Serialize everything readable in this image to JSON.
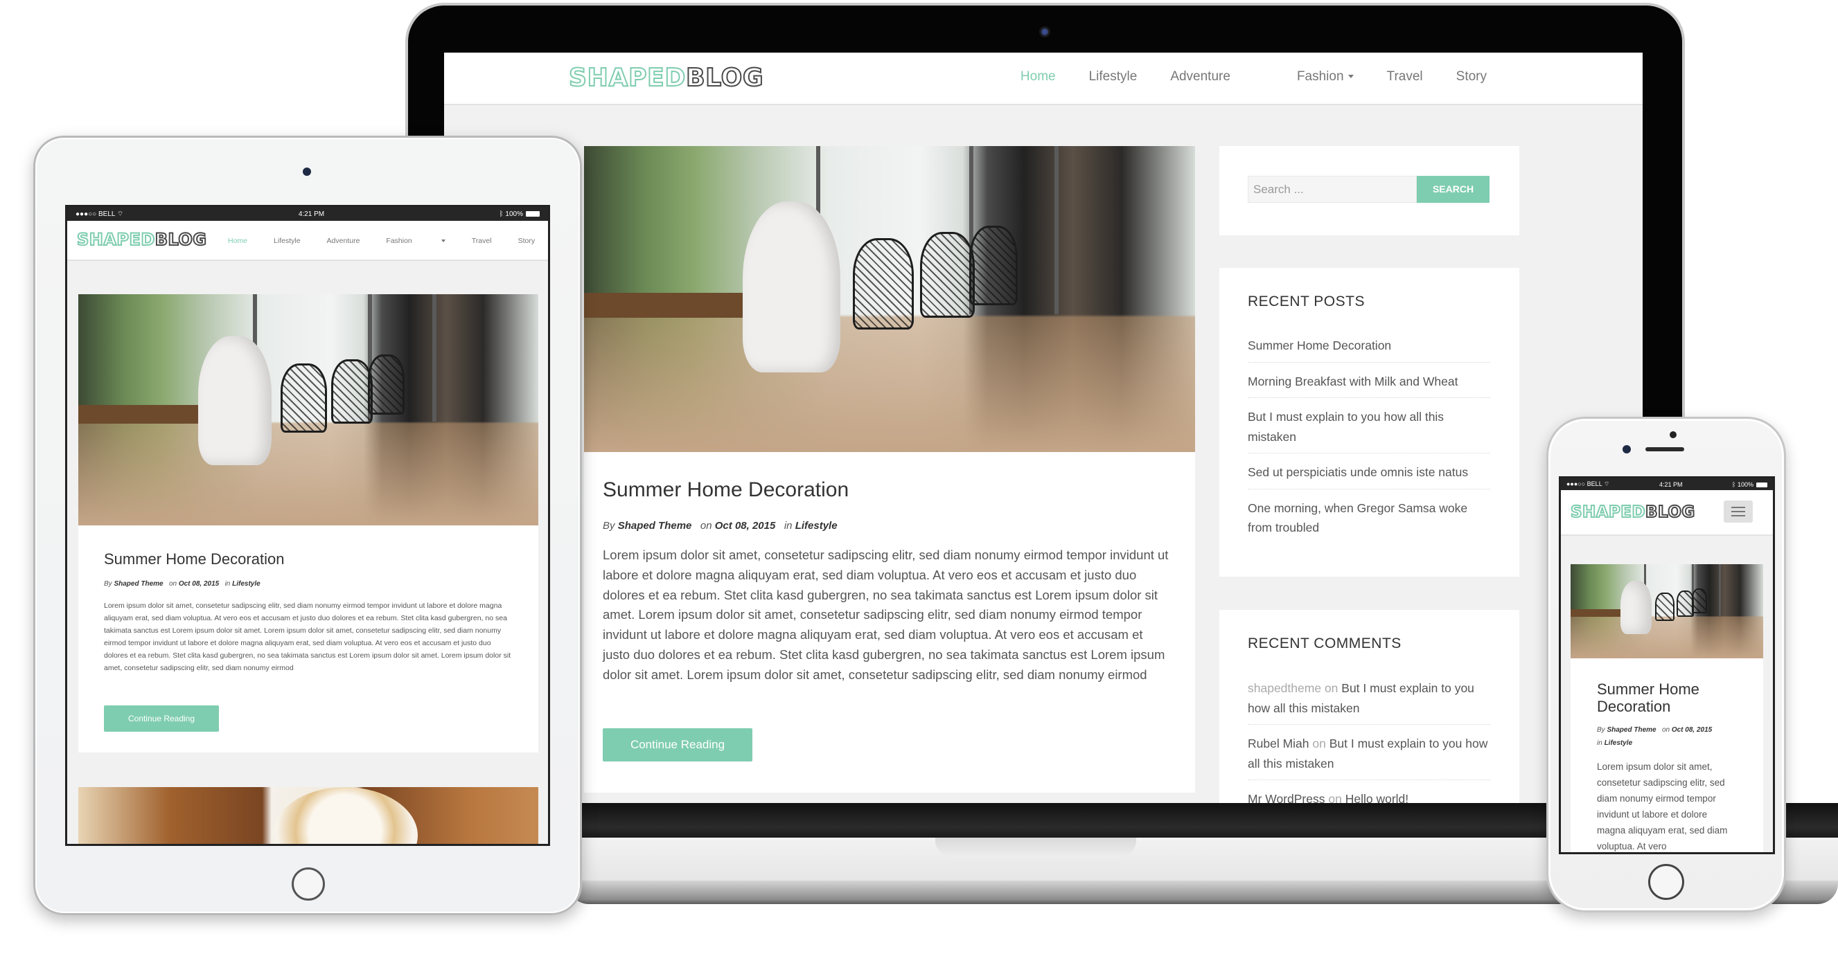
{
  "site": {
    "logo_part1": "SHAPED",
    "logo_part2": "BLOG",
    "accent_color": "#7fcdb0"
  },
  "nav": {
    "items": [
      {
        "label": "Home",
        "active": true
      },
      {
        "label": "Lifestyle",
        "active": false
      },
      {
        "label": "Adventure",
        "active": false
      },
      {
        "label": "Fashion",
        "active": false,
        "has_dropdown": true
      },
      {
        "label": "Travel",
        "active": false
      },
      {
        "label": "Story",
        "active": false
      }
    ]
  },
  "statusbar": {
    "carrier": "●●●○○ BELL",
    "wifi_icon": "wifi-icon",
    "time": "4:21 PM",
    "bluetooth_icon": "bluetooth-icon",
    "battery": "100%"
  },
  "post": {
    "title": "Summer Home Decoration",
    "by_label": "By",
    "author": "Shaped Theme",
    "on_label": "on",
    "date": "Oct 08, 2015",
    "in_label": "in",
    "category": "Lifestyle",
    "excerpt": "Lorem ipsum dolor sit amet, consetetur sadipscing elitr, sed diam nonumy eirmod tempor invidunt ut labore et dolore magna aliquyam erat, sed diam voluptua. At vero eos et accusam et justo duo dolores et ea rebum. Stet clita kasd gubergren, no sea takimata sanctus est Lorem ipsum dolor sit amet. Lorem ipsum dolor sit amet, consetetur sadipscing elitr, sed diam nonumy eirmod tempor invidunt ut labore et dolore magna aliquyam erat, sed diam voluptua. At vero eos et accusam et justo duo dolores et ea rebum. Stet clita kasd gubergren, no sea takimata sanctus est Lorem ipsum dolor sit amet. Lorem ipsum dolor sit amet, consetetur sadipscing elitr, sed diam nonumy eirmod",
    "phone_excerpt": "Lorem ipsum dolor sit amet, consetetur sadipscing elitr, sed diam nonumy eirmod tempor invidunt ut labore et dolore magna aliquyam erat, sed diam voluptua. At vero",
    "continue_label": "Continue Reading"
  },
  "sidebar": {
    "search": {
      "placeholder": "Search ...",
      "button_label": "SEARCH"
    },
    "recent_posts": {
      "title": "RECENT POSTS",
      "items": [
        "Summer Home Decoration",
        "Morning Breakfast with Milk and Wheat",
        "But I must explain to you how all this mistaken",
        "Sed ut perspiciatis unde omnis iste natus",
        "One morning, when Gregor Samsa woke from troubled"
      ]
    },
    "recent_comments": {
      "title": "RECENT COMMENTS",
      "items": [
        {
          "author": "shapedtheme",
          "on": "on",
          "post": "But I must explain to you how all this mistaken"
        },
        {
          "author": "Rubel Miah",
          "on": "on",
          "post": "But I must explain to you how all this mistaken"
        },
        {
          "author": "Mr WordPress",
          "on": "on",
          "post": "Hello world!"
        }
      ]
    }
  }
}
